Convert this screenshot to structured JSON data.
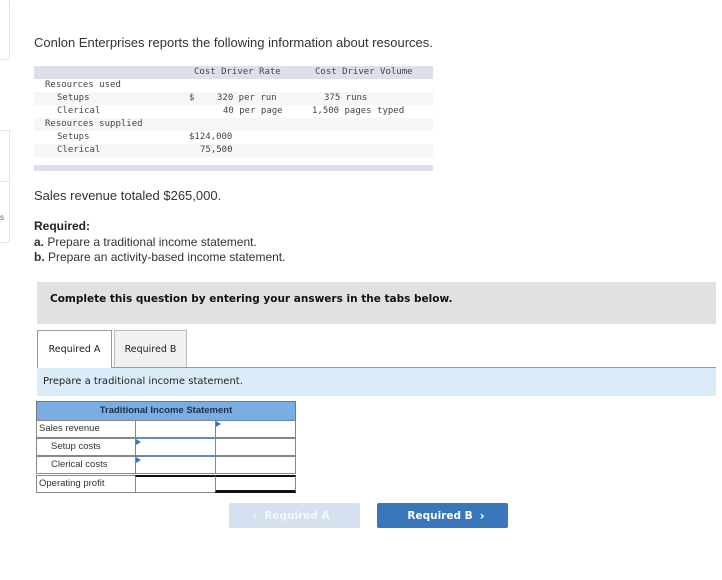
{
  "problem": {
    "intro": "Conlon Enterprises reports the following information about resources.",
    "table": {
      "headers": [
        "Cost Driver Rate",
        "Cost Driver Volume"
      ],
      "rows": [
        {
          "label": "Resources used",
          "indent": false,
          "rate_prefix": "",
          "rate": "",
          "volume": ""
        },
        {
          "label": "Setups",
          "indent": true,
          "rate_prefix": "$",
          "rate": "320 per run",
          "volume": "375 runs"
        },
        {
          "label": "Clerical",
          "indent": true,
          "rate_prefix": "",
          "rate": "40 per page",
          "volume": "1,500 pages typed"
        },
        {
          "label": "Resources supplied",
          "indent": false,
          "rate_prefix": "",
          "rate": "",
          "volume": ""
        },
        {
          "label": "Setups",
          "indent": true,
          "rate_prefix": "",
          "rate": "$124,000",
          "volume": ""
        },
        {
          "label": "Clerical",
          "indent": true,
          "rate_prefix": "",
          "rate": "75,500",
          "volume": ""
        }
      ]
    },
    "sales_text": "Sales revenue totaled $265,000.",
    "required_title": "Required:",
    "required_items": [
      {
        "letter": "a.",
        "text": " Prepare a traditional income statement."
      },
      {
        "letter": "b.",
        "text": " Prepare an activity-based income statement."
      }
    ]
  },
  "instruction": "Complete this question by entering your answers in the tabs below.",
  "tabs": [
    {
      "label": "Required A",
      "active": true
    },
    {
      "label": "Required B",
      "active": false
    }
  ],
  "prompt": "Prepare a traditional income statement.",
  "income_statement": {
    "title": "Traditional Income Statement",
    "rows": [
      {
        "label": "Sales revenue",
        "mid_value": "",
        "right_value": ""
      },
      {
        "label": "Setup costs",
        "mid_value": "",
        "right_value": ""
      },
      {
        "label": "Clerical costs",
        "mid_value": "",
        "right_value": ""
      },
      {
        "label": "Operating profit",
        "mid_value": "",
        "right_value": ""
      }
    ]
  },
  "nav": {
    "prev_label": "Required A",
    "next_label": "Required B",
    "prev_icon": "‹",
    "next_icon": "›"
  },
  "colors": {
    "accent": "#3a76bb",
    "header_blue": "#7aade3",
    "prompt_bg": "#dbecf9"
  }
}
